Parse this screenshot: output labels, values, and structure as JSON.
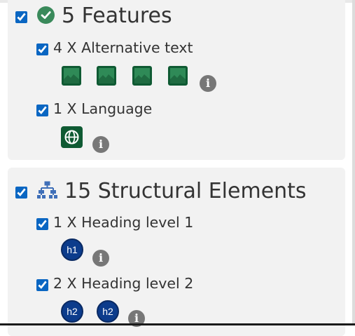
{
  "features": {
    "title": "5 Features",
    "checked": true,
    "icon": "check-circle-icon",
    "items": [
      {
        "label": "4 X Alternative text",
        "checked": true,
        "icon": "image-icon",
        "count": 4
      },
      {
        "label": "1 X Language",
        "checked": true,
        "icon": "globe-icon",
        "count": 1
      }
    ]
  },
  "structural": {
    "title": "15 Structural Elements",
    "checked": true,
    "icon": "sitemap-icon",
    "items": [
      {
        "label": "1 X Heading level 1",
        "checked": true,
        "badge": "h1",
        "count": 1
      },
      {
        "label": "2 X Heading level 2",
        "checked": true,
        "badge": "h2",
        "count": 2
      }
    ]
  },
  "info_glyph": "i",
  "colors": {
    "card_bg": "#f2f2f2",
    "feature_icon": "#0f5a33",
    "heading_badge": "#0c3c8c",
    "info_icon": "#777777",
    "checkbox": "#0a66c2"
  }
}
